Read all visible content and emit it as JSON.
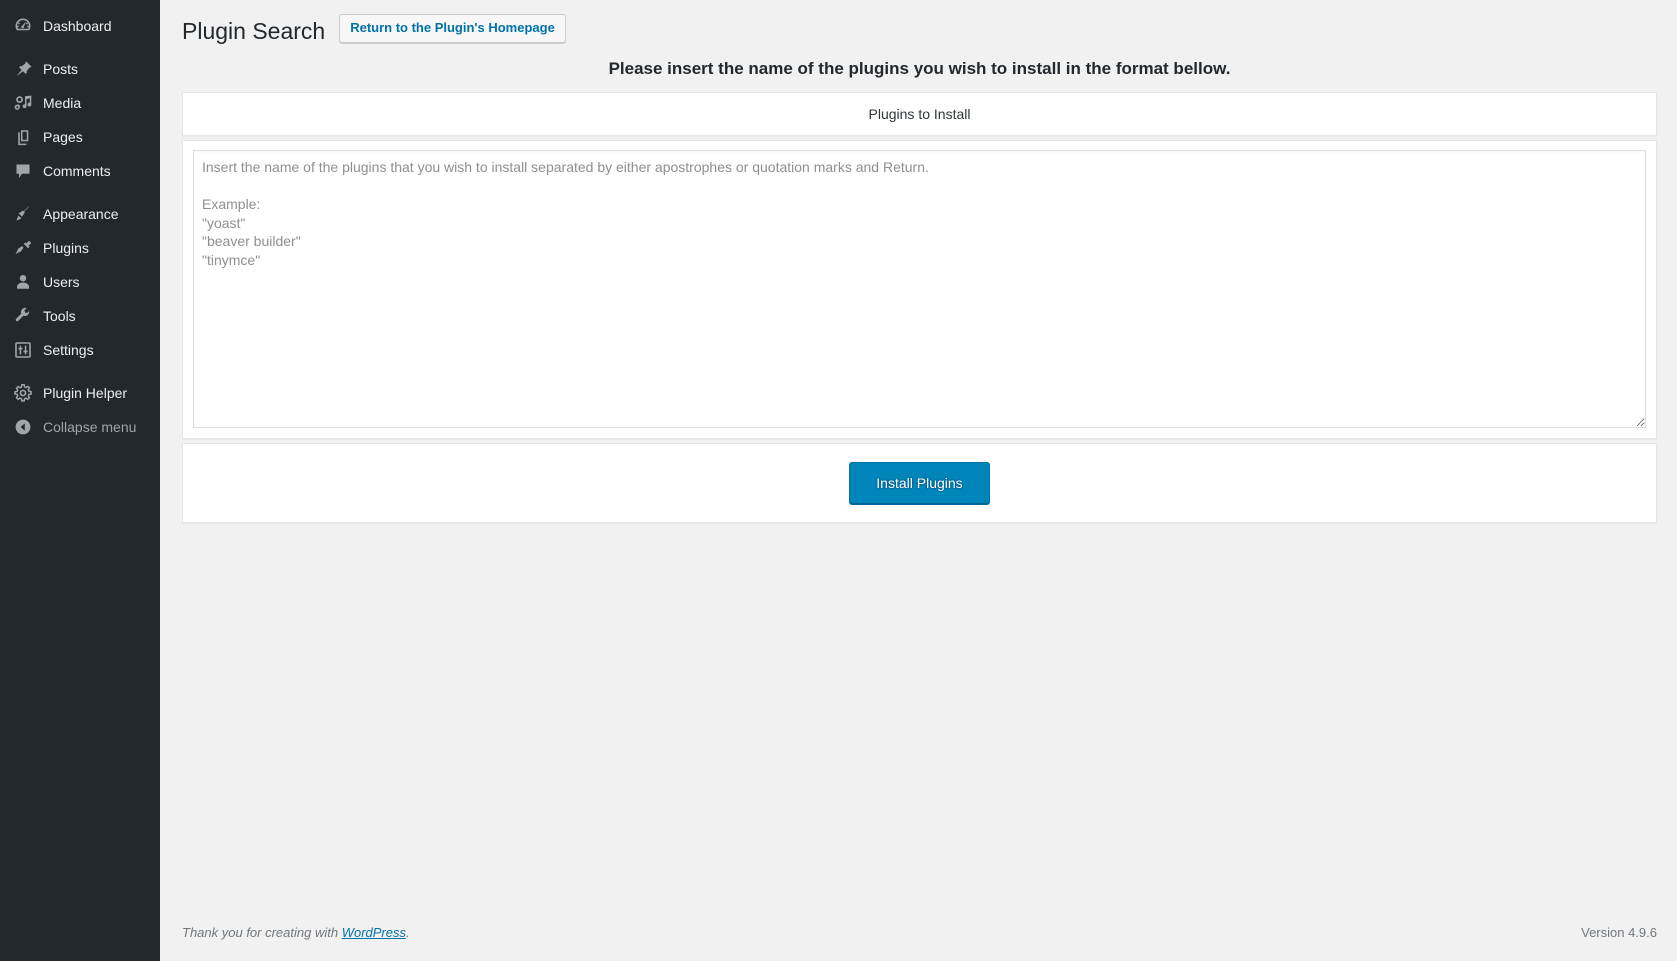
{
  "sidebar": {
    "groups": [
      {
        "items": [
          {
            "label": "Dashboard",
            "icon": "dashboard-icon",
            "name": "sidebar-item-dashboard"
          }
        ]
      },
      {
        "items": [
          {
            "label": "Posts",
            "icon": "pin-icon",
            "name": "sidebar-item-posts"
          },
          {
            "label": "Media",
            "icon": "media-icon",
            "name": "sidebar-item-media"
          },
          {
            "label": "Pages",
            "icon": "pages-icon",
            "name": "sidebar-item-pages"
          },
          {
            "label": "Comments",
            "icon": "comment-icon",
            "name": "sidebar-item-comments"
          }
        ]
      },
      {
        "items": [
          {
            "label": "Appearance",
            "icon": "paintbrush-icon",
            "name": "sidebar-item-appearance"
          },
          {
            "label": "Plugins",
            "icon": "plug-icon",
            "name": "sidebar-item-plugins"
          },
          {
            "label": "Users",
            "icon": "user-icon",
            "name": "sidebar-item-users"
          },
          {
            "label": "Tools",
            "icon": "wrench-icon",
            "name": "sidebar-item-tools"
          },
          {
            "label": "Settings",
            "icon": "sliders-icon",
            "name": "sidebar-item-settings"
          }
        ]
      },
      {
        "items": [
          {
            "label": "Plugin Helper",
            "icon": "gear-icon",
            "name": "sidebar-item-plugin-helper"
          }
        ]
      }
    ],
    "collapse": {
      "label": "Collapse menu",
      "icon": "collapse-arrow-icon"
    }
  },
  "header": {
    "title": "Plugin Search",
    "action_label": "Return to the Plugin's Homepage"
  },
  "main": {
    "lead": "Please insert the name of the plugins you wish to install in the format bellow.",
    "panel_title": "Plugins to Install",
    "textarea": {
      "value": "",
      "placeholder": "Insert the name of the plugins that you wish to install separated by either apostrophes or quotation marks and Return.\n\nExample:\n\"yoast\"\n\"beaver builder\"\n\"tinymce\""
    },
    "submit_label": "Install Plugins"
  },
  "footer": {
    "thanks_prefix": "Thank you for creating with ",
    "link_label": "WordPress",
    "thanks_suffix": ".",
    "version": "Version 4.9.6"
  },
  "colors": {
    "sidebar_bg": "#23282d",
    "accent_link": "#0073aa",
    "primary_button": "#0085ba",
    "page_bg": "#f1f1f1"
  }
}
